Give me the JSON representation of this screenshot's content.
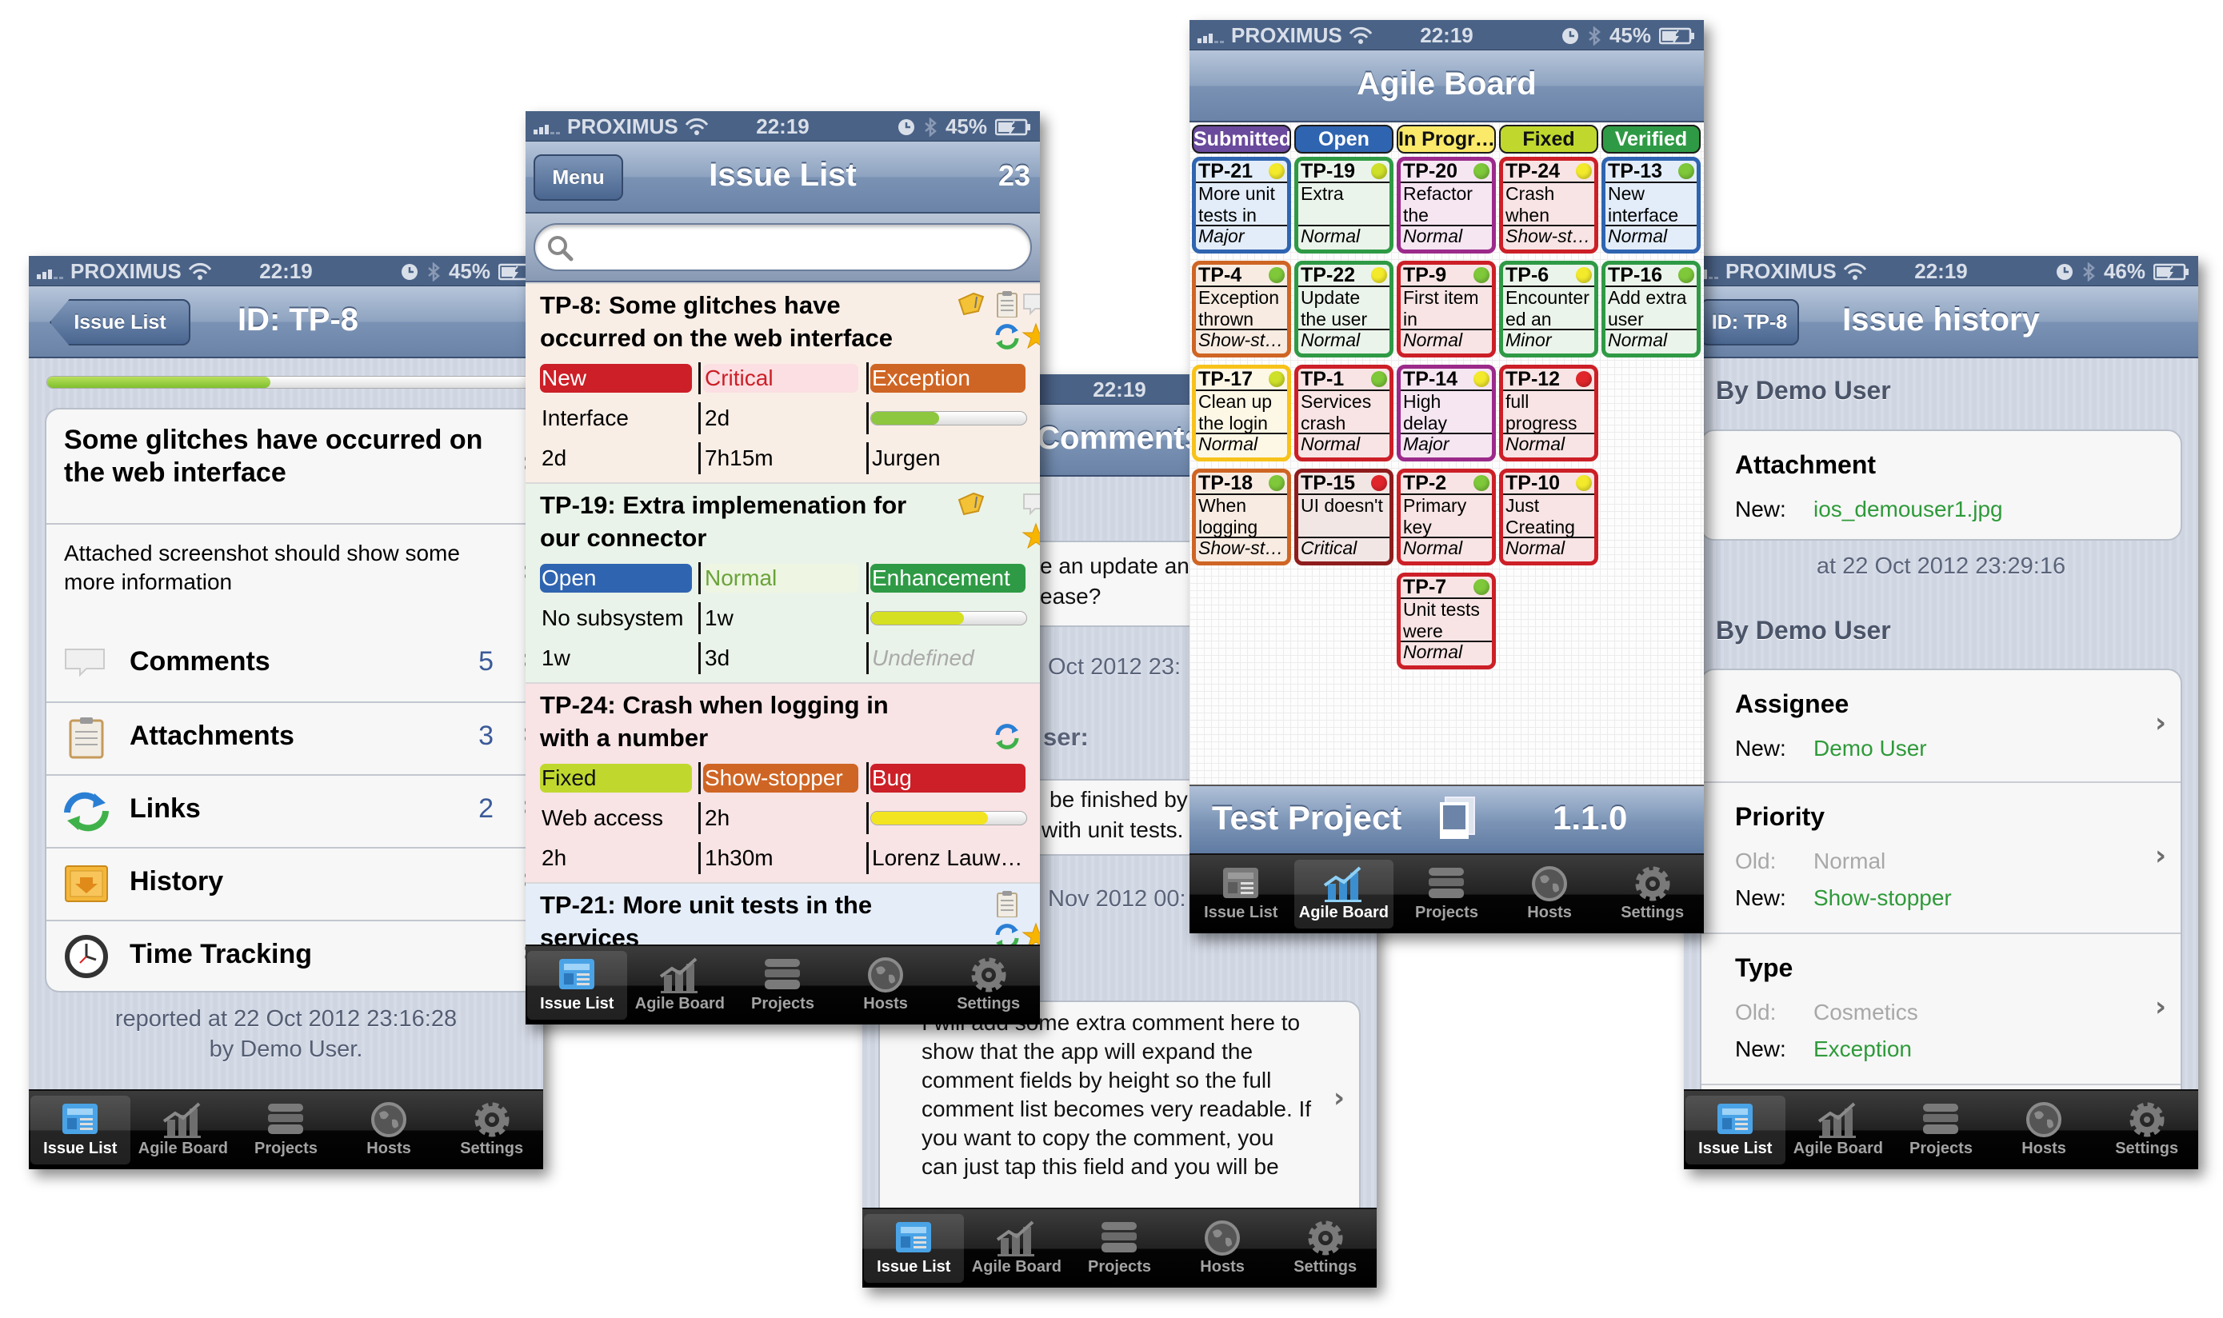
{
  "status_bar": {
    "carrier": "PROXIMUS",
    "time": "22:19"
  },
  "tab_bar": {
    "items": [
      {
        "label": "Issue List",
        "icon": "issue-list-icon"
      },
      {
        "label": "Agile Board",
        "icon": "agile-board-icon"
      },
      {
        "label": "Projects",
        "icon": "projects-icon"
      },
      {
        "label": "Hosts",
        "icon": "hosts-icon"
      },
      {
        "label": "Settings",
        "icon": "settings-icon"
      }
    ]
  },
  "colors": {
    "status_bar": "#4a6286",
    "link_green": "#2f9a3a",
    "count_blue": "#3b5a99"
  },
  "issue_detail": {
    "battery": "45%",
    "back_label": "Issue List",
    "title": "ID: TP-8",
    "progress": 0.45,
    "summary": "Some glitches have occurred on the web interface",
    "description": "Attached screenshot should show some more information",
    "rows": [
      {
        "label": "Comments",
        "count": "5",
        "icon": "comments-icon"
      },
      {
        "label": "Attachments",
        "count": "3",
        "icon": "attachments-icon"
      },
      {
        "label": "Links",
        "count": "2",
        "icon": "links-icon"
      },
      {
        "label": "History",
        "count": "",
        "icon": "history-icon"
      },
      {
        "label": "Time Tracking",
        "count": "",
        "icon": "clock-icon"
      }
    ],
    "footer_line1": "reported at 22 Oct 2012 23:16:28",
    "footer_line2": "by Demo User.",
    "active_tab": 0
  },
  "issue_list": {
    "battery": "45%",
    "menu_label": "Menu",
    "title": "Issue List",
    "count": "23",
    "search_placeholder": "",
    "active_tab": 0,
    "issues": [
      {
        "title": "TP-8: Some glitches have occurred on the web interface",
        "bg": "#f9eee6",
        "icons": {
          "tag": true,
          "attachment": true,
          "comment": true,
          "links": true,
          "star": true
        },
        "tags": [
          {
            "text": "New",
            "bg": "#cc1f27",
            "fg": "#ffffff"
          },
          {
            "text": "Critical",
            "bg": "#fbdfe2",
            "fg": "#cc1f27"
          },
          {
            "text": "Exception",
            "bg": "#cf6524",
            "fg": "#ffffff"
          }
        ],
        "row2": [
          "Interface",
          "2d"
        ],
        "progress": 0.44,
        "progress_color": "#8dc63f",
        "row3": [
          "2d",
          "7h15m",
          "Jurgen"
        ],
        "row3_muted": false
      },
      {
        "title": "TP-19: Extra implemenation for our connector",
        "bg": "#eaf3e9",
        "icons": {
          "tag": true,
          "attachment": false,
          "comment": true,
          "links": false,
          "star": true
        },
        "tags": [
          {
            "text": "Open",
            "bg": "#2f64b0",
            "fg": "#ffffff"
          },
          {
            "text": "Normal",
            "bg": "#eef5e2",
            "fg": "#6aa33a"
          },
          {
            "text": "Enhancement",
            "bg": "#2f9a45",
            "fg": "#ffffff"
          }
        ],
        "row2": [
          "No subsystem",
          "1w"
        ],
        "progress": 0.6,
        "progress_color": "#d4e021",
        "row3": [
          "1w",
          "3d",
          "Undefined"
        ],
        "row3_muted": true
      },
      {
        "title": "TP-24: Crash when logging in with a number",
        "bg": "#f8e3e5",
        "icons": {
          "tag": false,
          "attachment": false,
          "comment": false,
          "links": true,
          "star": false
        },
        "tags": [
          {
            "text": "Fixed",
            "bg": "#c0d82e",
            "fg": "#111111"
          },
          {
            "text": "Show-stopper",
            "bg": "#cf6524",
            "fg": "#ffffff"
          },
          {
            "text": "Bug",
            "bg": "#cc1f27",
            "fg": "#ffffff"
          }
        ],
        "row2": [
          "Web access",
          "2h"
        ],
        "progress": 0.75,
        "progress_color": "#f3e421",
        "row3": [
          "2h",
          "1h30m",
          "Lorenz Lauw…"
        ],
        "row3_muted": false
      },
      {
        "title": "TP-21: More unit tests in the services",
        "bg": "#e4edf8",
        "icons": {
          "tag": false,
          "attachment": true,
          "comment": false,
          "links": true,
          "star": true
        },
        "tags": [],
        "row2": [],
        "row3": []
      }
    ]
  },
  "comments": {
    "time": "22:19",
    "title": "Comments",
    "fragments": {
      "c1_line1": "e an update and",
      "c1_line2": "ease?",
      "date1": "Oct 2012 23:",
      "header2": "ser:",
      "c2_line1": "be finished by",
      "c2_line2": "with unit tests.",
      "date2": "Nov 2012 00:"
    },
    "comment_lines": [
      "I will add some extra comment here to",
      "show that the app will expand the",
      "comment fields by height so the full",
      "comment list becomes very readable. If",
      "you want to copy the comment, you",
      "can just tap this field and you will be"
    ],
    "active_tab": 0
  },
  "agile_board": {
    "battery": "45%",
    "title": "Agile Board",
    "project": "Test Project",
    "version": "1.1.0",
    "active_tab": 1,
    "columns": [
      {
        "name": "Submitted",
        "bg": "#6a4a9c",
        "fg": "#ffffff",
        "cards": [
          {
            "id": "TP-21",
            "text": "More unit tests in",
            "priority": "Major",
            "dot": "#f3ea2c",
            "border": "#2f64b0",
            "bg": "#e3edf9"
          },
          {
            "id": "TP-4",
            "text": "Exception thrown",
            "priority": "Show-st…",
            "dot": "#7ec83a",
            "border": "#cf6524",
            "bg": "#f8ece2"
          },
          {
            "id": "TP-17",
            "text": "Clean up the login",
            "priority": "Normal",
            "dot": "#cfe02a",
            "border": "#f7c21a",
            "bg": "#fdf7e6"
          },
          {
            "id": "TP-18",
            "text": "When logging",
            "priority": "Show-st…",
            "dot": "#7ec83a",
            "border": "#cf6524",
            "bg": "#f8ece2"
          }
        ]
      },
      {
        "name": "Open",
        "bg": "#2f64b0",
        "fg": "#ffffff",
        "cards": [
          {
            "id": "TP-19",
            "text": "Extra",
            "priority": "Normal",
            "dot": "#cfe02a",
            "border": "#2f9a45",
            "bg": "#ebf4ea"
          },
          {
            "id": "TP-22",
            "text": "Update the user",
            "priority": "Normal",
            "dot": "#f3ea2c",
            "border": "#2f9a45",
            "bg": "#ebf4ea"
          },
          {
            "id": "TP-1",
            "text": "Services crash",
            "priority": "Normal",
            "dot": "#7ec83a",
            "border": "#cc1f27",
            "bg": "#f8e4e4"
          },
          {
            "id": "TP-15",
            "text": "UI doesn't",
            "priority": "Critical",
            "dot": "#e0262b",
            "border": "#8e1c1c",
            "bg": "#f2e6e4"
          }
        ]
      },
      {
        "name": "In Progr…",
        "bg": "#fbe96a",
        "fg": "#111111",
        "cards": [
          {
            "id": "TP-20",
            "text": "Refactor the",
            "priority": "Normal",
            "dot": "#7ec83a",
            "border": "#9b2a8a",
            "bg": "#f5e6f2"
          },
          {
            "id": "TP-9",
            "text": "First item in",
            "priority": "Normal",
            "dot": "#7ec83a",
            "border": "#cc1f27",
            "bg": "#f8e4e4"
          },
          {
            "id": "TP-14",
            "text": "High delay",
            "priority": "Major",
            "dot": "#f3ea2c",
            "border": "#9b2a8a",
            "bg": "#f5e6f2"
          },
          {
            "id": "TP-2",
            "text": "Primary key",
            "priority": "Normal",
            "dot": "#7ec83a",
            "border": "#cc1f27",
            "bg": "#f8e4e4"
          },
          {
            "id": "TP-7",
            "text": "Unit tests were",
            "priority": "Normal",
            "dot": "#7ec83a",
            "border": "#cc1f27",
            "bg": "#f8e4e4"
          }
        ]
      },
      {
        "name": "Fixed",
        "bg": "#c0d82e",
        "fg": "#111111",
        "cards": [
          {
            "id": "TP-24",
            "text": "Crash when",
            "priority": "Show-st…",
            "dot": "#f3ea2c",
            "border": "#cc1f27",
            "bg": "#f8e4e4"
          },
          {
            "id": "TP-6",
            "text": "Encountered an",
            "priority": "Minor",
            "dot": "#f3ea2c",
            "border": "#2f9a45",
            "bg": "#ebf4ea"
          },
          {
            "id": "TP-12",
            "text": "full progress",
            "priority": "Normal",
            "dot": "#e0262b",
            "border": "#cc1f27",
            "bg": "#f8e4e4"
          },
          {
            "id": "TP-10",
            "text": "Just Creating",
            "priority": "Normal",
            "dot": "#f3ea2c",
            "border": "#cc1f27",
            "bg": "#f8e4e4"
          }
        ]
      },
      {
        "name": "Verified",
        "bg": "#2f9a45",
        "fg": "#ffffff",
        "cards": [
          {
            "id": "TP-13",
            "text": "New interface",
            "priority": "Normal",
            "dot": "#7ec83a",
            "border": "#2f64b0",
            "bg": "#e3edf9"
          },
          {
            "id": "TP-16",
            "text": "Add extra user",
            "priority": "Normal",
            "dot": "#7ec83a",
            "border": "#2f9a45",
            "bg": "#ebf4ea"
          }
        ]
      }
    ]
  },
  "history": {
    "battery": "46%",
    "back_label": "ID: TP-8",
    "title": "Issue history",
    "groups": [
      {
        "header": "By Demo User",
        "footer": "at 22 Oct 2012 23:29:16",
        "changes": [
          {
            "field": "Attachment",
            "old": null,
            "new": "ios_demouser1.jpg"
          }
        ]
      },
      {
        "header": "By Demo User",
        "footer": "",
        "changes": [
          {
            "field": "Assignee",
            "old": null,
            "new": "Demo User"
          },
          {
            "field": "Priority",
            "old": "Normal",
            "new": "Show-stopper"
          },
          {
            "field": "Type",
            "old": "Cosmetics",
            "new": "Exception"
          }
        ]
      }
    ],
    "old_label": "Old:",
    "new_label": "New:",
    "active_tab": 0
  }
}
